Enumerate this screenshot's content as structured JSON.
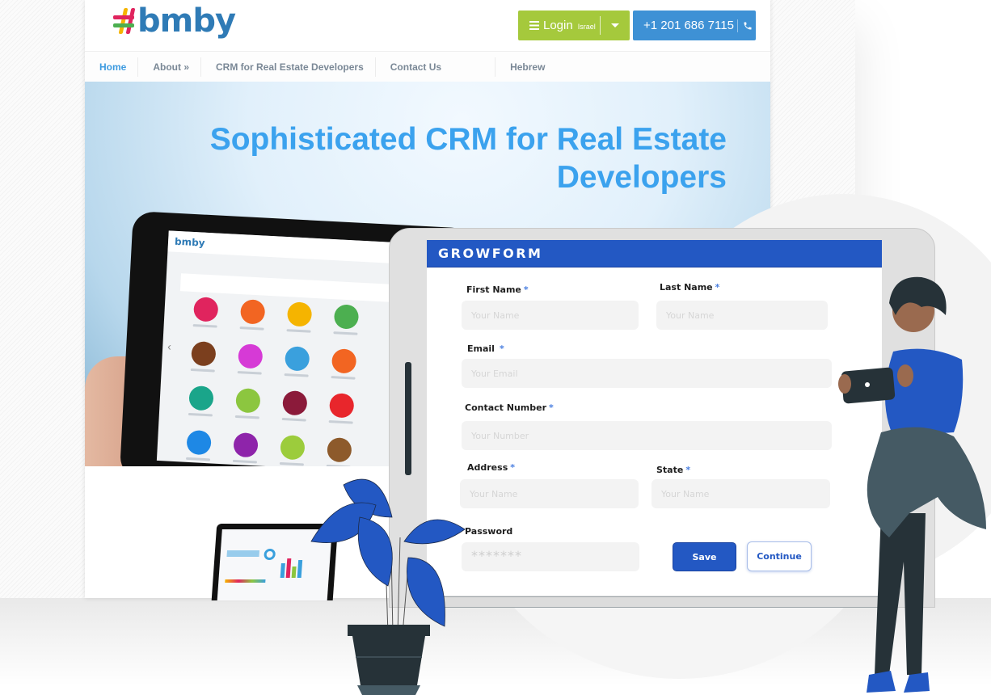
{
  "site": {
    "logo_text": "bmby",
    "login_button": {
      "label": "Login",
      "sub_label": "Israel"
    },
    "phone_button": {
      "label": "+1 201 686 7115"
    },
    "nav": [
      {
        "label": "Home",
        "active": true
      },
      {
        "label": "About »",
        "active": false
      },
      {
        "label": "CRM for Real Estate Developers",
        "active": false
      },
      {
        "label": "Contact Us",
        "active": false
      },
      {
        "label": "Hebrew",
        "active": false
      }
    ],
    "hero": {
      "title_line1": "Sophisticated CRM for Real Estate",
      "title_line2": "Developers"
    },
    "tablet_logo": "bmby"
  },
  "form": {
    "title": "GROWFORM",
    "required_mark": "*",
    "fields": {
      "first_name": {
        "label": "First Name",
        "placeholder": "Your Name",
        "required": true
      },
      "last_name": {
        "label": "Last Name",
        "placeholder": "Your Name",
        "required": true
      },
      "email": {
        "label": "Email",
        "placeholder": "Your Email",
        "required": true
      },
      "contact_number": {
        "label": "Contact  Number",
        "placeholder": "Your Number",
        "required": true
      },
      "address": {
        "label": "Address",
        "placeholder": "Your Name",
        "required": true
      },
      "state": {
        "label": "State",
        "placeholder": "Your Name",
        "required": true
      },
      "password": {
        "label": "Password",
        "placeholder": "*******",
        "required": false
      }
    },
    "save_label": "Save",
    "continue_label": "Continue"
  },
  "colors": {
    "brand_blue": "#2f7bb6",
    "login_green": "#a5c93c",
    "phone_blue": "#3e91d5",
    "nav_active": "#3e9be0",
    "hero_title": "#3ba2ee",
    "form_accent": "#2358c3",
    "plant_leaf": "#2358c3",
    "dark": "#263238"
  },
  "icons": {
    "login": "hamburger-menu-icon",
    "dropdown": "caret-down-icon",
    "phone": "phone-icon"
  },
  "tablet_apps": [
    "#e0245e",
    "#f26522",
    "#f5b400",
    "#4caf50",
    "#7b3f1e",
    "#d63ad6",
    "#3aa0dd",
    "#f26522",
    "#1aa58a",
    "#8cc63f",
    "#8b1a3a",
    "#e8262c",
    "#1e88e5",
    "#8e24aa",
    "#9ccc3c",
    "#8d5a2b"
  ]
}
